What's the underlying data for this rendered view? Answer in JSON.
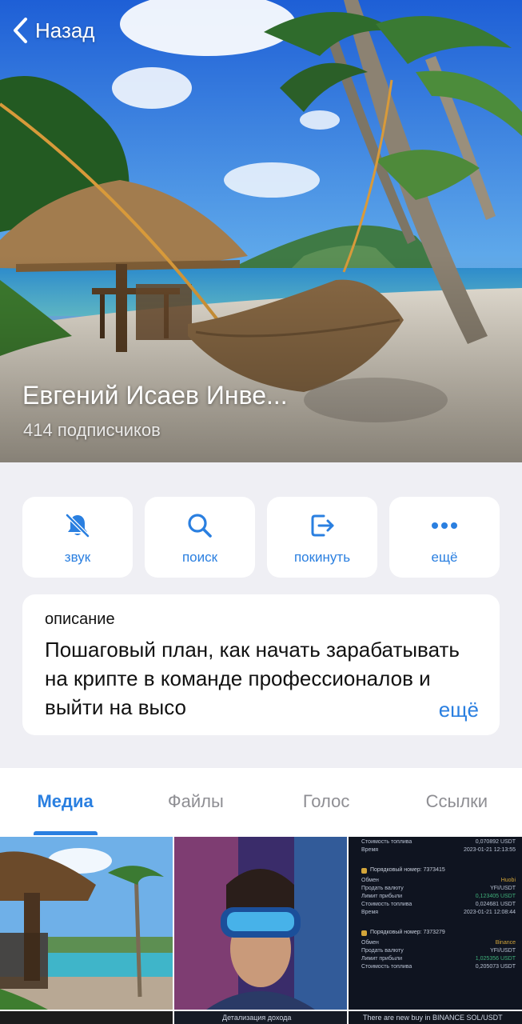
{
  "header": {
    "back_label": "Назад",
    "channel_name": "Евгений Исаев Инве...",
    "subscribers": "414 подписчиков"
  },
  "actions": [
    {
      "label": "звук",
      "icon": "bell-slash-icon"
    },
    {
      "label": "поиск",
      "icon": "search-icon"
    },
    {
      "label": "покинуть",
      "icon": "leave-icon"
    },
    {
      "label": "ещё",
      "icon": "more-dots-icon"
    }
  ],
  "description": {
    "caption": "описание",
    "text": "Пошаговый план, как начать зарабатывать на крипте в команде профессионалов и выйти на высо",
    "more_label": "ещё"
  },
  "tabs": [
    {
      "label": "Медиа",
      "active": true
    },
    {
      "label": "Файлы",
      "active": false
    },
    {
      "label": "Голос",
      "active": false
    },
    {
      "label": "Ссылки",
      "active": false
    }
  ],
  "media": {
    "trade_screenshot": {
      "rows_top": [
        {
          "k": "Стоимость топлива",
          "v": "0,070892 USDT"
        },
        {
          "k": "Время",
          "v": "2023-01-21 12:13:55"
        }
      ],
      "order1_header": "Порядковый номер: 7373415",
      "order1_rows": [
        {
          "k": "Обмен",
          "v": "Huobi"
        },
        {
          "k": "Продать валюту",
          "v": "YFI/USDT"
        },
        {
          "k": "Лимит прибыли",
          "v": "0,123405 USDT"
        },
        {
          "k": "Стоимость топлива",
          "v": "0,024681 USDT"
        },
        {
          "k": "Время",
          "v": "2023-01-21 12:08:44"
        }
      ],
      "order2_header": "Порядковый номер: 7373279",
      "order2_rows": [
        {
          "k": "Обмен",
          "v": "Binance"
        },
        {
          "k": "Продать валюту",
          "v": "YFI/USDT"
        },
        {
          "k": "Лимит прибыли",
          "v": "1,025356 USDT"
        },
        {
          "k": "Стоимость топлива",
          "v": "0,205073 USDT"
        }
      ]
    },
    "bottom_mid_text": "Детализация дохода",
    "bottom_right_text": "There are new buy in BINANCE SOL/USDT"
  },
  "colors": {
    "accent": "#2a7fe0",
    "background": "#efeff4",
    "card": "#ffffff"
  }
}
